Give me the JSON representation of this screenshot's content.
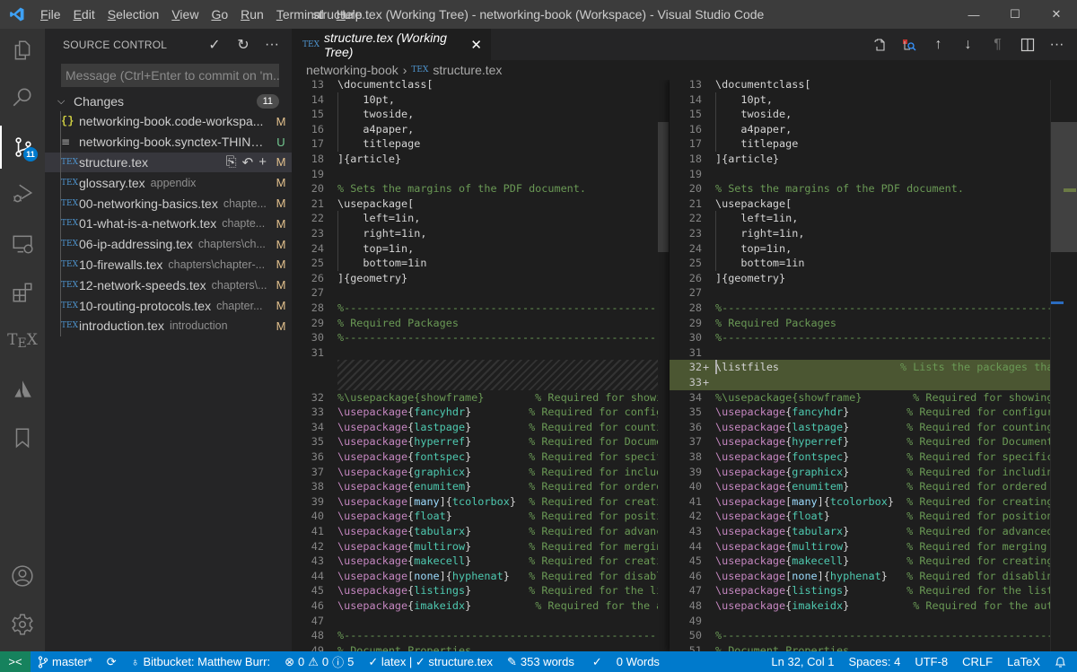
{
  "titlebar": {
    "menu": [
      {
        "label": "File",
        "mnemonic": "F",
        "rest": "ile"
      },
      {
        "label": "Edit",
        "mnemonic": "E",
        "rest": "dit"
      },
      {
        "label": "Selection",
        "mnemonic": "S",
        "rest": "election"
      },
      {
        "label": "View",
        "mnemonic": "V",
        "rest": "iew"
      },
      {
        "label": "Go",
        "mnemonic": "G",
        "rest": "o"
      },
      {
        "label": "Run",
        "mnemonic": "R",
        "rest": "un"
      },
      {
        "label": "Terminal",
        "mnemonic": "T",
        "rest": "erminal"
      },
      {
        "label": "Help",
        "mnemonic": "H",
        "rest": "elp"
      }
    ],
    "window_title": "structure.tex (Working Tree) - networking-book (Workspace) - Visual Studio Code",
    "controls": {
      "minimize": "—",
      "maximize": "☐",
      "close": "✕"
    }
  },
  "activitybar": {
    "items": [
      {
        "name": "explorer",
        "icon": "files-icon"
      },
      {
        "name": "search",
        "icon": "search-icon"
      },
      {
        "name": "source-control",
        "icon": "source-control-icon",
        "badge": "11",
        "active": true
      },
      {
        "name": "run-debug",
        "icon": "debug-icon"
      },
      {
        "name": "remote-explorer",
        "icon": "remote-explorer-icon"
      },
      {
        "name": "extensions",
        "icon": "extensions-icon"
      },
      {
        "name": "tex",
        "icon": "tex-icon",
        "label": "TEX"
      },
      {
        "name": "atlassian",
        "icon": "atlassian-icon"
      },
      {
        "name": "bookmarks",
        "icon": "bookmark-icon"
      }
    ],
    "bottom": [
      {
        "name": "accounts",
        "icon": "account-icon"
      },
      {
        "name": "manage",
        "icon": "gear-icon"
      }
    ]
  },
  "sidebar": {
    "title": "SOURCE CONTROL",
    "actions": {
      "commit": "✓",
      "refresh": "↻",
      "more": "···"
    },
    "commit_placeholder": "Message (Ctrl+Enter to commit on 'm...",
    "changes": {
      "label": "Changes",
      "count": "11",
      "files": [
        {
          "icon": "json",
          "name": "networking-book.code-workspa...",
          "dir": "",
          "status": "M"
        },
        {
          "icon": "txt",
          "name": "networking-book.synctex-THINK...",
          "dir": "",
          "status": "U"
        },
        {
          "icon": "tex",
          "name": "structure.tex",
          "dir": "",
          "status": "M",
          "selected": true
        },
        {
          "icon": "tex",
          "name": "glossary.tex",
          "dir": "appendix",
          "status": "M"
        },
        {
          "icon": "tex",
          "name": "00-networking-basics.tex",
          "dir": "chapte...",
          "status": "M"
        },
        {
          "icon": "tex",
          "name": "01-what-is-a-network.tex",
          "dir": "chapte...",
          "status": "M"
        },
        {
          "icon": "tex",
          "name": "06-ip-addressing.tex",
          "dir": "chapters\\ch...",
          "status": "M"
        },
        {
          "icon": "tex",
          "name": "10-firewalls.tex",
          "dir": "chapters\\chapter-...",
          "status": "M"
        },
        {
          "icon": "tex",
          "name": "12-network-speeds.tex",
          "dir": "chapters\\...",
          "status": "M"
        },
        {
          "icon": "tex",
          "name": "10-routing-protocols.tex",
          "dir": "chapter...",
          "status": "M"
        },
        {
          "icon": "tex",
          "name": "introduction.tex",
          "dir": "introduction",
          "status": "M"
        }
      ]
    }
  },
  "editor": {
    "tab": {
      "icon": "TEX",
      "label": "structure.tex (Working Tree)",
      "close": "✕"
    },
    "breadcrumb": {
      "folder": "networking-book",
      "sep": "›",
      "file_icon": "TEX",
      "file": "structure.tex"
    },
    "left_lines": [
      {
        "n": "13",
        "t": [
          [
            "c-br",
            "\\documentclass["
          ]
        ]
      },
      {
        "n": "14",
        "t": [
          [
            "c-br",
            "    10pt,"
          ]
        ]
      },
      {
        "n": "15",
        "t": [
          [
            "c-br",
            "    twoside,"
          ]
        ]
      },
      {
        "n": "16",
        "t": [
          [
            "c-br",
            "    a4paper,"
          ]
        ]
      },
      {
        "n": "17",
        "t": [
          [
            "c-br",
            "    titlepage"
          ]
        ]
      },
      {
        "n": "18",
        "t": [
          [
            "c-br",
            "]{article}"
          ]
        ]
      },
      {
        "n": "19",
        "t": []
      },
      {
        "n": "20",
        "t": [
          [
            "c-comment",
            "% Sets the margins of the PDF document."
          ]
        ]
      },
      {
        "n": "21",
        "t": [
          [
            "c-br",
            "\\usepackage["
          ]
        ]
      },
      {
        "n": "22",
        "t": [
          [
            "c-br",
            "    left=1in,"
          ]
        ]
      },
      {
        "n": "23",
        "t": [
          [
            "c-br",
            "    right=1in,"
          ]
        ]
      },
      {
        "n": "24",
        "t": [
          [
            "c-br",
            "    top=1in,"
          ]
        ]
      },
      {
        "n": "25",
        "t": [
          [
            "c-br",
            "    bottom=1in"
          ]
        ]
      },
      {
        "n": "26",
        "t": [
          [
            "c-br",
            "]{geometry}"
          ]
        ]
      },
      {
        "n": "27",
        "t": []
      },
      {
        "n": "28",
        "t": [
          [
            "c-comment",
            "%------------------------------------------------------------"
          ]
        ]
      },
      {
        "n": "29",
        "t": [
          [
            "c-comment",
            "% Required Packages"
          ]
        ]
      },
      {
        "n": "30",
        "t": [
          [
            "c-comment",
            "%------------------------------------------------------------"
          ]
        ]
      },
      {
        "n": "31",
        "t": []
      },
      {
        "n": "",
        "hatch": true
      },
      {
        "n": "",
        "hatch": true
      },
      {
        "n": "32",
        "t": [
          [
            "c-comment",
            "%\\usepackage{showframe}        % Required for showing"
          ]
        ]
      },
      {
        "n": "33",
        "pkg": "fancyhdr",
        "pad": "         ",
        "cm": "% Required for configuri"
      },
      {
        "n": "34",
        "pkg": "lastpage",
        "pad": "         ",
        "cm": "% Required for counting"
      },
      {
        "n": "35",
        "pkg": "hyperref",
        "pad": "         ",
        "cm": "% Required for Document"
      },
      {
        "n": "36",
        "pkg": "fontspec",
        "pad": "         ",
        "cm": "% Required for specifica"
      },
      {
        "n": "37",
        "pkg": "graphicx",
        "pad": "         ",
        "cm": "% Required for including"
      },
      {
        "n": "38",
        "pkg": "enumitem",
        "pad": "         ",
        "cm": "% Required for ordered a"
      },
      {
        "n": "39",
        "opt": "many",
        "pkg": "tcolorbox",
        "pad": "  ",
        "cm": "% Required for creating"
      },
      {
        "n": "40",
        "pkg": "float",
        "pad": "            ",
        "cm": "% Required for positioni"
      },
      {
        "n": "41",
        "pkg": "tabularx",
        "pad": "         ",
        "cm": "% Required for advanced"
      },
      {
        "n": "42",
        "pkg": "multirow",
        "pad": "         ",
        "cm": "% Required for merging r"
      },
      {
        "n": "43",
        "pkg": "makecell",
        "pad": "         ",
        "cm": "% Required for creating"
      },
      {
        "n": "44",
        "opt": "none",
        "pkg": "hyphenat",
        "pad": "   ",
        "cm": "% Required for disabling"
      },
      {
        "n": "45",
        "pkg": "listings",
        "pad": "         ",
        "cm": "% Required for the listi"
      },
      {
        "n": "46",
        "pkg": "imakeidx",
        "pad": "          ",
        "cm": "% Required for the auto"
      },
      {
        "n": "47",
        "t": []
      },
      {
        "n": "48",
        "t": [
          [
            "c-comment",
            "%------------------------------------------------------------"
          ]
        ]
      },
      {
        "n": "49",
        "t": [
          [
            "c-comment",
            "% Document Properties"
          ]
        ]
      }
    ],
    "right_lines": [
      {
        "n": "13",
        "t": [
          [
            "c-br",
            "\\documentclass["
          ]
        ]
      },
      {
        "n": "14",
        "t": [
          [
            "c-br",
            "    10pt,"
          ]
        ]
      },
      {
        "n": "15",
        "t": [
          [
            "c-br",
            "    twoside,"
          ]
        ]
      },
      {
        "n": "16",
        "t": [
          [
            "c-br",
            "    a4paper,"
          ]
        ]
      },
      {
        "n": "17",
        "t": [
          [
            "c-br",
            "    titlepage"
          ]
        ]
      },
      {
        "n": "18",
        "t": [
          [
            "c-br",
            "]{article}"
          ]
        ]
      },
      {
        "n": "19",
        "t": []
      },
      {
        "n": "20",
        "t": [
          [
            "c-comment",
            "% Sets the margins of the PDF document."
          ]
        ]
      },
      {
        "n": "21",
        "t": [
          [
            "c-br",
            "\\usepackage["
          ]
        ]
      },
      {
        "n": "22",
        "t": [
          [
            "c-br",
            "    left=1in,"
          ]
        ]
      },
      {
        "n": "23",
        "t": [
          [
            "c-br",
            "    right=1in,"
          ]
        ]
      },
      {
        "n": "24",
        "t": [
          [
            "c-br",
            "    top=1in,"
          ]
        ]
      },
      {
        "n": "25",
        "t": [
          [
            "c-br",
            "    bottom=1in"
          ]
        ]
      },
      {
        "n": "26",
        "t": [
          [
            "c-br",
            "]{geometry}"
          ]
        ]
      },
      {
        "n": "27",
        "t": []
      },
      {
        "n": "28",
        "t": [
          [
            "c-comment",
            "%------------------------------------------------------------"
          ]
        ]
      },
      {
        "n": "29",
        "t": [
          [
            "c-comment",
            "% Required Packages"
          ]
        ]
      },
      {
        "n": "30",
        "t": [
          [
            "c-comment",
            "%------------------------------------------------------------"
          ]
        ]
      },
      {
        "n": "31",
        "t": []
      },
      {
        "n": "32",
        "added": true,
        "t": [
          [
            "c-br",
            "\\listfiles"
          ],
          [
            "c-br",
            "                   "
          ],
          [
            "c-comment",
            "% Lists the packages tha"
          ]
        ]
      },
      {
        "n": "33",
        "added": true,
        "t": []
      },
      {
        "n": "34",
        "t": [
          [
            "c-comment",
            "%\\usepackage{showframe}        % Required for showing"
          ]
        ]
      },
      {
        "n": "35",
        "pkg": "fancyhdr",
        "pad": "         ",
        "cm": "% Required for configuri"
      },
      {
        "n": "36",
        "pkg": "lastpage",
        "pad": "         ",
        "cm": "% Required for counting"
      },
      {
        "n": "37",
        "pkg": "hyperref",
        "pad": "         ",
        "cm": "% Required for Document"
      },
      {
        "n": "38",
        "pkg": "fontspec",
        "pad": "         ",
        "cm": "% Required for specifica"
      },
      {
        "n": "39",
        "pkg": "graphicx",
        "pad": "         ",
        "cm": "% Required for including"
      },
      {
        "n": "40",
        "pkg": "enumitem",
        "pad": "         ",
        "cm": "% Required for ordered a"
      },
      {
        "n": "41",
        "opt": "many",
        "pkg": "tcolorbox",
        "pad": "  ",
        "cm": "% Required for creating"
      },
      {
        "n": "42",
        "pkg": "float",
        "pad": "            ",
        "cm": "% Required for positioni"
      },
      {
        "n": "43",
        "pkg": "tabularx",
        "pad": "         ",
        "cm": "% Required for advanced"
      },
      {
        "n": "44",
        "pkg": "multirow",
        "pad": "         ",
        "cm": "% Required for merging r"
      },
      {
        "n": "45",
        "pkg": "makecell",
        "pad": "         ",
        "cm": "% Required for creating"
      },
      {
        "n": "46",
        "opt": "none",
        "pkg": "hyphenat",
        "pad": "   ",
        "cm": "% Required for disabling"
      },
      {
        "n": "47",
        "pkg": "listings",
        "pad": "         ",
        "cm": "% Required for the listi"
      },
      {
        "n": "48",
        "pkg": "imakeidx",
        "pad": "          ",
        "cm": "% Required for the auto"
      },
      {
        "n": "49",
        "t": []
      },
      {
        "n": "50",
        "t": [
          [
            "c-comment",
            "%------------------------------------------------------------"
          ]
        ]
      },
      {
        "n": "51",
        "t": [
          [
            "c-comment",
            "% Document Properties"
          ]
        ]
      }
    ]
  },
  "statusbar": {
    "remote": "><",
    "branch": "master*",
    "sync": "⟳",
    "bitbucket": "Bitbucket: Matthew Burr:",
    "errors": "0",
    "warnings": "0",
    "infos": "5",
    "build": "✓ latex | ✓ structure.tex",
    "word_count": "353 words",
    "check": "✓",
    "words2": "0 Words",
    "position": "Ln 32, Col 1",
    "spaces": "Spaces: 4",
    "encoding": "UTF-8",
    "eol": "CRLF",
    "language": "LaTeX",
    "bell": "🔔"
  }
}
